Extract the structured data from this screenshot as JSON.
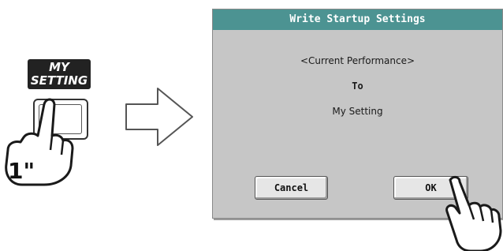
{
  "hardware": {
    "button_label_line1": "MY",
    "button_label_line2": "SETTING",
    "press_duration": "1\""
  },
  "dialog": {
    "title": "Write Startup Settings",
    "source": "<Current Performance>",
    "connector": "To",
    "target": "My Setting",
    "cancel_label": "Cancel",
    "ok_label": "OK"
  },
  "colors": {
    "title_bar": "#4c9392",
    "dialog_bg": "#c6c6c6",
    "label_bg": "#222222"
  },
  "icons": [
    "pointing-hand-icon",
    "right-arrow-icon"
  ]
}
